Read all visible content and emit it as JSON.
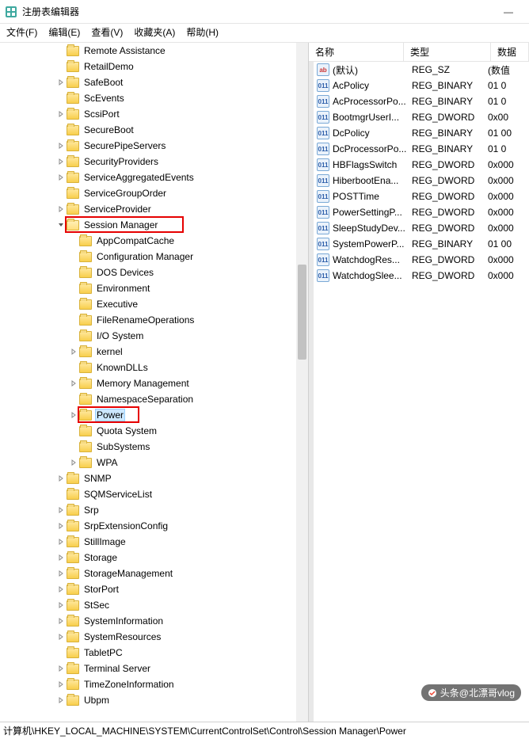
{
  "window": {
    "title": "注册表编辑器"
  },
  "menu": {
    "file": "文件(F)",
    "edit": "编辑(E)",
    "view": "查看(V)",
    "favorites": "收藏夹(A)",
    "help": "帮助(H)"
  },
  "tree": [
    {
      "indent": 8,
      "label": "Remote Assistance",
      "expander": ""
    },
    {
      "indent": 8,
      "label": "RetailDemo",
      "expander": ""
    },
    {
      "indent": 8,
      "label": "SafeBoot",
      "expander": ">"
    },
    {
      "indent": 8,
      "label": "ScEvents",
      "expander": ""
    },
    {
      "indent": 8,
      "label": "ScsiPort",
      "expander": ">"
    },
    {
      "indent": 8,
      "label": "SecureBoot",
      "expander": ""
    },
    {
      "indent": 8,
      "label": "SecurePipeServers",
      "expander": ">"
    },
    {
      "indent": 8,
      "label": "SecurityProviders",
      "expander": ">"
    },
    {
      "indent": 8,
      "label": "ServiceAggregatedEvents",
      "expander": ">"
    },
    {
      "indent": 8,
      "label": "ServiceGroupOrder",
      "expander": ""
    },
    {
      "indent": 8,
      "label": "ServiceProvider",
      "expander": ">"
    },
    {
      "indent": 8,
      "label": "Session Manager",
      "expander": "v",
      "open": true,
      "hl1": true
    },
    {
      "indent": 9,
      "label": "AppCompatCache",
      "expander": ""
    },
    {
      "indent": 9,
      "label": "Configuration Manager",
      "expander": ""
    },
    {
      "indent": 9,
      "label": "DOS Devices",
      "expander": ""
    },
    {
      "indent": 9,
      "label": "Environment",
      "expander": ""
    },
    {
      "indent": 9,
      "label": "Executive",
      "expander": ""
    },
    {
      "indent": 9,
      "label": "FileRenameOperations",
      "expander": ""
    },
    {
      "indent": 9,
      "label": "I/O System",
      "expander": ""
    },
    {
      "indent": 9,
      "label": "kernel",
      "expander": ">"
    },
    {
      "indent": 9,
      "label": "KnownDLLs",
      "expander": ""
    },
    {
      "indent": 9,
      "label": "Memory Management",
      "expander": ">"
    },
    {
      "indent": 9,
      "label": "NamespaceSeparation",
      "expander": ""
    },
    {
      "indent": 9,
      "label": "Power",
      "expander": ">",
      "selected": true,
      "hl2": true
    },
    {
      "indent": 9,
      "label": "Quota System",
      "expander": ""
    },
    {
      "indent": 9,
      "label": "SubSystems",
      "expander": ""
    },
    {
      "indent": 9,
      "label": "WPA",
      "expander": ">"
    },
    {
      "indent": 8,
      "label": "SNMP",
      "expander": ">"
    },
    {
      "indent": 8,
      "label": "SQMServiceList",
      "expander": ""
    },
    {
      "indent": 8,
      "label": "Srp",
      "expander": ">"
    },
    {
      "indent": 8,
      "label": "SrpExtensionConfig",
      "expander": ">"
    },
    {
      "indent": 8,
      "label": "StillImage",
      "expander": ">"
    },
    {
      "indent": 8,
      "label": "Storage",
      "expander": ">"
    },
    {
      "indent": 8,
      "label": "StorageManagement",
      "expander": ">"
    },
    {
      "indent": 8,
      "label": "StorPort",
      "expander": ">"
    },
    {
      "indent": 8,
      "label": "StSec",
      "expander": ">"
    },
    {
      "indent": 8,
      "label": "SystemInformation",
      "expander": ">"
    },
    {
      "indent": 8,
      "label": "SystemResources",
      "expander": ">"
    },
    {
      "indent": 8,
      "label": "TabletPC",
      "expander": ""
    },
    {
      "indent": 8,
      "label": "Terminal Server",
      "expander": ">"
    },
    {
      "indent": 8,
      "label": "TimeZoneInformation",
      "expander": ">"
    },
    {
      "indent": 8,
      "label": "Ubpm",
      "expander": ">"
    }
  ],
  "list": {
    "headers": {
      "name": "名称",
      "type": "类型",
      "data": "数据"
    },
    "rows": [
      {
        "icon": "str",
        "name": "(默认)",
        "type": "REG_SZ",
        "data": "(数值"
      },
      {
        "icon": "bin",
        "name": "AcPolicy",
        "type": "REG_BINARY",
        "data": "01 0"
      },
      {
        "icon": "bin",
        "name": "AcProcessorPo...",
        "type": "REG_BINARY",
        "data": "01 0"
      },
      {
        "icon": "bin",
        "name": "BootmgrUserI...",
        "type": "REG_DWORD",
        "data": "0x00"
      },
      {
        "icon": "bin",
        "name": "DcPolicy",
        "type": "REG_BINARY",
        "data": "01 00"
      },
      {
        "icon": "bin",
        "name": "DcProcessorPo...",
        "type": "REG_BINARY",
        "data": "01 0"
      },
      {
        "icon": "bin",
        "name": "HBFlagsSwitch",
        "type": "REG_DWORD",
        "data": "0x000"
      },
      {
        "icon": "bin",
        "name": "HiberbootEna...",
        "type": "REG_DWORD",
        "data": "0x000"
      },
      {
        "icon": "bin",
        "name": "POSTTime",
        "type": "REG_DWORD",
        "data": "0x000"
      },
      {
        "icon": "bin",
        "name": "PowerSettingP...",
        "type": "REG_DWORD",
        "data": "0x000"
      },
      {
        "icon": "bin",
        "name": "SleepStudyDev...",
        "type": "REG_DWORD",
        "data": "0x000"
      },
      {
        "icon": "bin",
        "name": "SystemPowerP...",
        "type": "REG_BINARY",
        "data": "01 00"
      },
      {
        "icon": "bin",
        "name": "WatchdogRes...",
        "type": "REG_DWORD",
        "data": "0x000"
      },
      {
        "icon": "bin",
        "name": "WatchdogSlee...",
        "type": "REG_DWORD",
        "data": "0x000"
      }
    ]
  },
  "statusbar": "计算机\\HKEY_LOCAL_MACHINE\\SYSTEM\\CurrentControlSet\\Control\\Session Manager\\Power",
  "watermark": "头条@北漂哥vlog"
}
